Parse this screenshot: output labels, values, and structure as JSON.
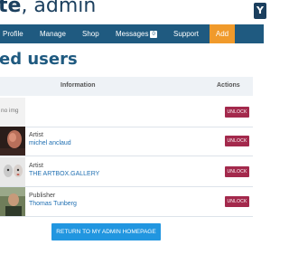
{
  "brand": {
    "part1": "te",
    "part2": ", admin"
  },
  "top_button_label": "Y",
  "nav": {
    "items": [
      {
        "label": "Profile"
      },
      {
        "label": "Manage"
      },
      {
        "label": "Shop"
      },
      {
        "label": "Messages",
        "badge": "0"
      },
      {
        "label": "Support"
      },
      {
        "label": "Add"
      }
    ],
    "active_color": "#f09a2b",
    "bar_color": "#1f5a80"
  },
  "page": {
    "title": "ed users"
  },
  "table": {
    "headers": {
      "information": "Information",
      "actions": "Actions"
    },
    "rows": [
      {
        "thumb": "no img",
        "role": "",
        "name": "",
        "action": "UNLOCK"
      },
      {
        "thumb": "portrait-avatar",
        "role": "Artist",
        "name": "michel anclaud",
        "action": "UNLOCK"
      },
      {
        "thumb": "gallery-avatar",
        "role": "Artist",
        "name": "THE ARTBOX.GALLERY",
        "action": "UNLOCK"
      },
      {
        "thumb": "publisher-avatar",
        "role": "Publisher",
        "name": "Thomas Tunberg",
        "action": "UNLOCK"
      }
    ]
  },
  "return_button": "RETURN TO MY ADMIN HOMEPAGE",
  "colors": {
    "unlock": "#a3294c",
    "return": "#2196e0",
    "link": "#1f6fb2",
    "title": "#1f5a80"
  }
}
